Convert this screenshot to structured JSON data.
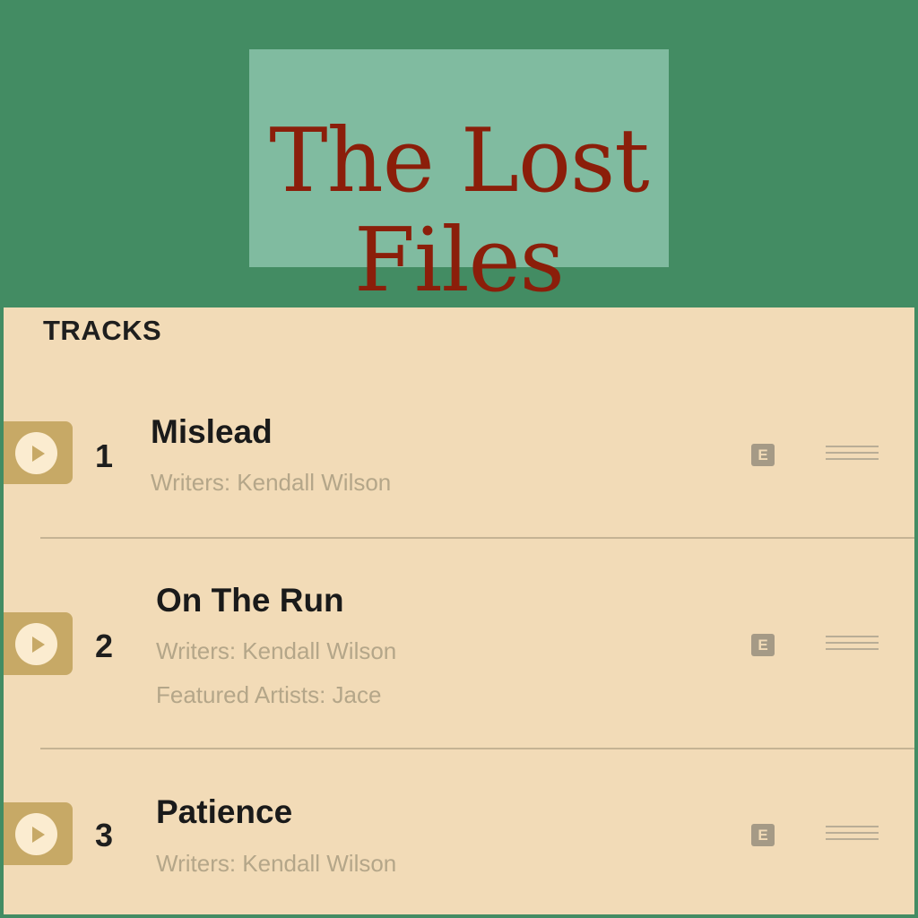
{
  "album": {
    "title_line1": "The Lost",
    "title_line2": "Files"
  },
  "tracks_heading": "TRACKS",
  "tracks": [
    {
      "number": "1",
      "title": "Mislead",
      "writers": "Writers: Kendall Wilson",
      "explicit": "E"
    },
    {
      "number": "2",
      "title": "On The Run",
      "writers": "Writers: Kendall Wilson",
      "featured": "Featured Artists: Jace",
      "explicit": "E"
    },
    {
      "number": "3",
      "title": "Patience",
      "writers": "Writers: Kendall Wilson",
      "explicit": "E"
    }
  ],
  "colors": {
    "background": "#438c63",
    "title_box": "#80bba0",
    "title_text": "#8b1e0a",
    "panel": "#f2dbb7",
    "play_button": "#c7a966",
    "meta_text": "#b4a689"
  },
  "icons": {
    "play": "play-icon",
    "explicit": "explicit-badge-icon",
    "menu": "menu-icon"
  }
}
